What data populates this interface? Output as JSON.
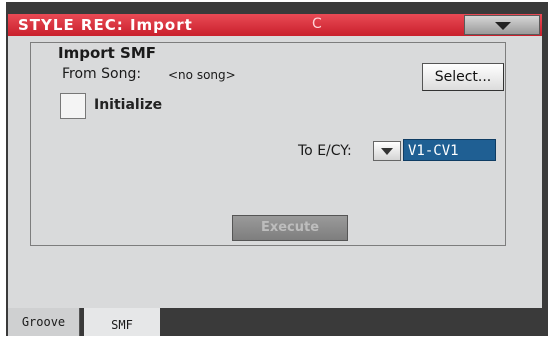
{
  "window": {
    "title": "STYLE REC: Import",
    "subtitle": "C"
  },
  "import_smf": {
    "group_title": "Import SMF",
    "from_song_label": "From Song:",
    "from_song_value": "<no song>",
    "select_label": "Select...",
    "initialize_label": "Initialize",
    "initialize_checked": false,
    "to_ecv_label": "To E/CY:",
    "to_ecv_value": "V1-CV1",
    "execute_label": "Execute"
  },
  "tabs": [
    {
      "label": "Groove",
      "active": false
    },
    {
      "label": "SMF",
      "active": true
    }
  ],
  "colors": {
    "title_bar": "#d8303b",
    "panel_bg": "#d9dadb",
    "selected_value_bg": "#1f5f93",
    "frame": "#3a3a3a"
  }
}
